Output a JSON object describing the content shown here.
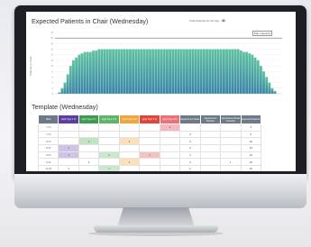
{
  "chart": {
    "title": "Expected Patients in Chair (Wednesday)",
    "total_label": "Total Patients for the day:",
    "total_value": "41",
    "y_axis_label": "Patients in Chair",
    "max_capacity_label": "Max Capacity",
    "bar_color_top": "#5fc3a0",
    "bar_color_bottom": "#3a84a8",
    "max_line_color": "#4a4a4a"
  },
  "chart_data": {
    "type": "bar",
    "ylim": [
      0,
      22
    ],
    "max_capacity": 20,
    "values": [
      0,
      0.5,
      2,
      4,
      7,
      10,
      12,
      13,
      14,
      14.5,
      15,
      15,
      15,
      15.5,
      15.5,
      16,
      16,
      16,
      16,
      16,
      16,
      16,
      16,
      16,
      16,
      16,
      16,
      16,
      16,
      16,
      16,
      16,
      16,
      16,
      16,
      16,
      16,
      16,
      16,
      16,
      16,
      16,
      16,
      16,
      16,
      16,
      16,
      16,
      16,
      16,
      16,
      16,
      16,
      16,
      16,
      16,
      16,
      16,
      16,
      16,
      16,
      16,
      16,
      16,
      16,
      15.5,
      15,
      15,
      14.5,
      14,
      13,
      12,
      10,
      8,
      6,
      4,
      2,
      1,
      0,
      0
    ]
  },
  "template": {
    "title": "Template (Wednesday)",
    "headers": [
      {
        "label": "Slots",
        "color": "#6c7a87"
      },
      {
        "label": "Appt Type 1 hr",
        "color": "#5b3ea0"
      },
      {
        "label": "Appt Type 2 hr",
        "color": "#3f9a4f"
      },
      {
        "label": "Appt Type 3 hr",
        "color": "#5fb36a"
      },
      {
        "label": "Appt Type 4 hr",
        "color": "#f0a63a"
      },
      {
        "label": "Appt Type 5 hr",
        "color": "#e0473c"
      },
      {
        "label": "Appt Type 6 hr",
        "color": "#e8717a"
      },
      {
        "label": "Appointment Starts",
        "color": "#6c7a87"
      },
      {
        "label": "Appointment Finishes",
        "color": "#6c7a87"
      },
      {
        "label": "Appointment Ends Overtime",
        "color": "#6c7a87"
      },
      {
        "label": "Expected Patients",
        "color": "#6c7a87"
      }
    ],
    "rows": [
      {
        "time": "7:00",
        "cells": [
          "",
          "",
          "",
          "",
          "",
          "1",
          "",
          "",
          "",
          "3"
        ],
        "colors": [
          "",
          "",
          "",
          "",
          "",
          "#f4b9be",
          "",
          "",
          "",
          ""
        ]
      },
      {
        "time": "7:30",
        "cells": [
          "",
          "",
          "",
          "",
          "",
          "",
          "3",
          "",
          "",
          "6"
        ],
        "colors": [
          "",
          "",
          "",
          "",
          "",
          "",
          "",
          "",
          "",
          ""
        ]
      },
      {
        "time": "8:00",
        "cells": [
          "",
          "2",
          "",
          "1",
          "",
          "",
          "3",
          "",
          "",
          "10"
        ],
        "colors": [
          "",
          "#c2e4c4",
          "",
          "#fbe0bb",
          "",
          "",
          "",
          "",
          "",
          ""
        ]
      },
      {
        "time": "8:30",
        "cells": [
          "1",
          "",
          "",
          "",
          "",
          "",
          "2",
          "",
          "",
          "12"
        ],
        "colors": [
          "#cfc4e6",
          "",
          "",
          "",
          "",
          "",
          "",
          "",
          "",
          ""
        ]
      },
      {
        "time": "9:00",
        "cells": [
          "1",
          "",
          "2",
          "",
          "1",
          "",
          "4",
          "",
          "",
          "14"
        ],
        "colors": [
          "#cfc4e6",
          "",
          "#cbe8cd",
          "",
          "#f7c2bd",
          "",
          "",
          "",
          "",
          ""
        ]
      },
      {
        "time": "9:30",
        "cells": [
          "",
          "1",
          "",
          "1",
          "",
          "",
          "2",
          "",
          "1",
          "15"
        ],
        "colors": [
          "",
          "",
          "",
          "#fbe0bb",
          "",
          "",
          "",
          "",
          "",
          ""
        ]
      },
      {
        "time": "10:00",
        "cells": [
          "1",
          "",
          "1",
          "",
          "",
          "",
          "2",
          "",
          "",
          "16"
        ],
        "colors": [
          "",
          "",
          "#cbe8cd",
          "",
          "",
          "",
          "",
          "",
          "",
          ""
        ]
      }
    ]
  }
}
